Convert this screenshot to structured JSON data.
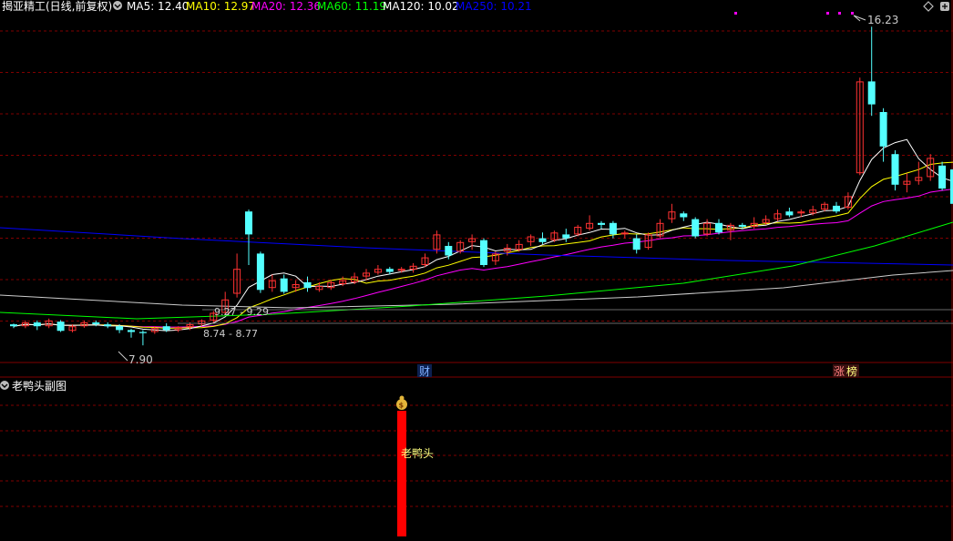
{
  "header": {
    "stock": "揭亚精工",
    "mode": "(日线,前复权)",
    "ma": [
      {
        "label": "MA5: 12.40",
        "color": "#ffffff"
      },
      {
        "label": "MA10: 12.97",
        "color": "#ffff00"
      },
      {
        "label": "MA20: 12.36",
        "color": "#ff00ff"
      },
      {
        "label": "MA60: 11.19",
        "color": "#00ff00"
      },
      {
        "label": "MA120: 10.02",
        "color": "#ffffff"
      },
      {
        "label": "MA250: 10.21",
        "color": "#0000ff"
      }
    ]
  },
  "annotations": {
    "high": "16.23",
    "low": "7.90",
    "range1": "9.27 - 9.29",
    "range2": "8.74 - 8.77",
    "badge_fin": "财",
    "badge_zhang": "涨",
    "badge_bang": "榜"
  },
  "sub": {
    "title": "老鸭头副图",
    "signal_label": "老鸭头",
    "signal_icon": "money-bag-icon"
  },
  "colors": {
    "up": "#ff3232",
    "down": "#54ffff",
    "grid": "#800000",
    "signal": "#ff0000"
  },
  "chart_data": {
    "type": "candlestick",
    "price_range": [
      7.5,
      16.5
    ],
    "candles": [
      [
        8.45,
        8.4,
        8.47,
        8.35
      ],
      [
        8.4,
        8.5,
        8.55,
        8.35
      ],
      [
        8.5,
        8.4,
        8.55,
        8.3
      ],
      [
        8.4,
        8.55,
        8.6,
        8.35
      ],
      [
        8.52,
        8.28,
        8.56,
        8.25
      ],
      [
        8.28,
        8.4,
        8.45,
        8.24
      ],
      [
        8.4,
        8.5,
        8.55,
        8.36
      ],
      [
        8.5,
        8.45,
        8.55,
        8.4
      ],
      [
        8.45,
        8.4,
        8.5,
        8.35
      ],
      [
        8.4,
        8.3,
        8.45,
        8.22
      ],
      [
        8.3,
        8.25,
        8.33,
        8.1
      ],
      [
        8.25,
        8.22,
        8.3,
        7.9
      ],
      [
        8.25,
        8.35,
        8.4,
        8.2
      ],
      [
        8.4,
        8.3,
        8.48,
        8.25
      ],
      [
        8.3,
        8.38,
        8.4,
        8.25
      ],
      [
        8.38,
        8.45,
        8.5,
        8.3
      ],
      [
        8.45,
        8.55,
        8.58,
        8.4
      ],
      [
        8.55,
        8.75,
        8.8,
        8.5
      ],
      [
        8.75,
        9.1,
        9.3,
        8.7
      ],
      [
        9.25,
        9.9,
        10.3,
        9.15
      ],
      [
        11.4,
        10.8,
        11.45,
        10.0
      ],
      [
        10.3,
        9.35,
        10.35,
        9.27
      ],
      [
        9.4,
        9.6,
        9.75,
        9.3
      ],
      [
        9.65,
        9.3,
        9.75,
        9.25
      ],
      [
        9.4,
        9.5,
        9.6,
        9.3
      ],
      [
        9.55,
        9.4,
        9.7,
        9.3
      ],
      [
        9.35,
        9.45,
        9.55,
        9.3
      ],
      [
        9.4,
        9.55,
        9.6,
        9.35
      ],
      [
        9.5,
        9.6,
        9.7,
        9.45
      ],
      [
        9.55,
        9.7,
        9.8,
        9.5
      ],
      [
        9.7,
        9.8,
        9.9,
        9.6
      ],
      [
        9.8,
        9.9,
        10.0,
        9.75
      ],
      [
        9.9,
        9.82,
        9.95,
        9.75
      ],
      [
        9.85,
        9.9,
        9.95,
        9.8
      ],
      [
        9.88,
        9.98,
        10.05,
        9.8
      ],
      [
        10.0,
        10.2,
        10.3,
        9.95
      ],
      [
        10.4,
        10.8,
        10.9,
        10.3
      ],
      [
        10.5,
        10.25,
        10.6,
        10.15
      ],
      [
        10.35,
        10.6,
        10.65,
        10.3
      ],
      [
        10.6,
        10.7,
        10.8,
        10.4
      ],
      [
        10.65,
        10.0,
        10.7,
        9.95
      ],
      [
        10.1,
        10.3,
        10.35,
        10.0
      ],
      [
        10.35,
        10.45,
        10.55,
        10.25
      ],
      [
        10.4,
        10.55,
        10.65,
        10.35
      ],
      [
        10.6,
        10.75,
        10.8,
        10.5
      ],
      [
        10.7,
        10.6,
        10.85,
        10.55
      ],
      [
        10.65,
        10.85,
        10.9,
        10.6
      ],
      [
        10.8,
        10.7,
        10.95,
        10.6
      ],
      [
        10.8,
        11.0,
        11.05,
        10.75
      ],
      [
        10.95,
        11.1,
        11.3,
        10.9
      ],
      [
        11.1,
        11.05,
        11.15,
        10.95
      ],
      [
        11.1,
        10.8,
        11.15,
        10.7
      ],
      [
        10.8,
        10.85,
        10.9,
        10.7
      ],
      [
        10.7,
        10.4,
        10.8,
        10.3
      ],
      [
        10.45,
        10.8,
        10.85,
        10.4
      ],
      [
        10.75,
        11.1,
        11.2,
        10.7
      ],
      [
        11.2,
        11.4,
        11.6,
        11.1
      ],
      [
        11.35,
        11.25,
        11.4,
        11.15
      ],
      [
        11.2,
        10.75,
        11.25,
        10.7
      ],
      [
        10.8,
        11.1,
        11.2,
        10.75
      ],
      [
        11.1,
        10.85,
        11.2,
        10.8
      ],
      [
        10.9,
        11.05,
        11.1,
        10.65
      ],
      [
        11.05,
        11.0,
        11.1,
        10.95
      ],
      [
        11.0,
        11.1,
        11.25,
        10.95
      ],
      [
        11.1,
        11.2,
        11.3,
        11.05
      ],
      [
        11.2,
        11.35,
        11.45,
        11.15
      ],
      [
        11.4,
        11.3,
        11.5,
        11.25
      ],
      [
        11.35,
        11.4,
        11.45,
        11.25
      ],
      [
        11.35,
        11.45,
        11.55,
        11.3
      ],
      [
        11.45,
        11.6,
        11.65,
        11.4
      ],
      [
        11.55,
        11.4,
        11.65,
        11.35
      ],
      [
        11.5,
        11.8,
        11.9,
        11.45
      ],
      [
        12.4,
        14.8,
        14.9,
        12.35
      ],
      [
        14.8,
        14.2,
        16.23,
        13.9
      ],
      [
        14.0,
        13.1,
        14.1,
        12.7
      ],
      [
        12.9,
        12.1,
        13.0,
        11.95
      ],
      [
        12.1,
        12.2,
        12.4,
        11.9
      ],
      [
        12.2,
        12.3,
        12.7,
        12.1
      ],
      [
        12.3,
        12.8,
        12.9,
        12.2
      ],
      [
        12.6,
        12.0,
        12.7,
        11.95
      ],
      [
        12.5,
        11.6,
        12.55,
        11.5
      ],
      [
        11.7,
        11.8,
        11.85,
        11.4
      ]
    ]
  }
}
